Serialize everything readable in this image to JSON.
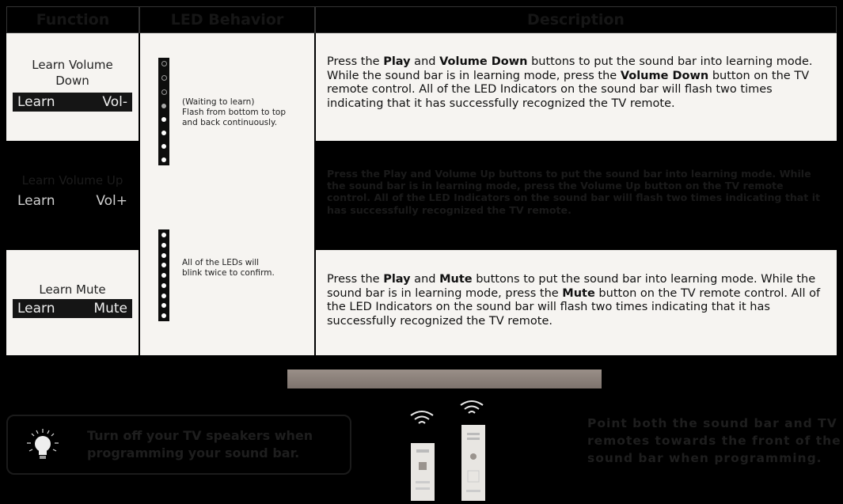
{
  "headers": {
    "function": "Function",
    "led": "LED Behavior",
    "description": "Description"
  },
  "rows": [
    {
      "function_name": "Learn Volume Down",
      "tag_left": "Learn",
      "tag_right": "Vol-",
      "desc_parts": [
        "Press the ",
        "Play",
        " and ",
        "Volume Down",
        " buttons to put the sound bar into learning mode. While the sound bar is in learning mode, press the ",
        "Volume Down",
        " button on the TV remote control. All of the LED Indicators on the sound bar will flash two times indicating that it has successfully recognized the TV remote."
      ]
    },
    {
      "function_name": "Learn Volume Up",
      "tag_left": "Learn",
      "tag_right": "Vol+",
      "desc_parts": [
        "Press the ",
        "Play",
        " and ",
        "Volume Up",
        " buttons to put the sound bar into learning mode. While the sound bar is in learning mode, press the ",
        "Volume Up",
        " button on the TV remote control. All of the LED Indicators on the sound bar will flash two times indicating that it has successfully recognized the TV remote."
      ]
    },
    {
      "function_name": "Learn Mute",
      "tag_left": "Learn",
      "tag_right": "Mute",
      "desc_parts": [
        "Press the ",
        "Play",
        " and ",
        "Mute",
        " buttons to put the sound bar into learning mode. While the sound bar is in learning mode, press the ",
        "Mute",
        " button on the TV remote control. All of the LED Indicators on the sound bar will flash two times indicating that it has successfully recognized the TV remote."
      ]
    }
  ],
  "led_behavior": {
    "waiting_line1": "(Waiting to learn)",
    "waiting_line2": "Flash from bottom to top",
    "waiting_line3": "and back continuously.",
    "confirm_line1": "All of the LEDs will",
    "confirm_line2": "blink twice to confirm."
  },
  "tips": {
    "speakers_line1": "Turn off your TV speakers when",
    "speakers_line2": "programming your sound bar.",
    "remotes_line1": "Point both the sound bar and TV",
    "remotes_line2": "remotes towards the front of the",
    "remotes_line3": "sound bar when programming."
  },
  "colors": {
    "background": "#000000",
    "light_row": "#f6f4f1",
    "soundbar": "#8a807a",
    "text": "#111111"
  },
  "icons": {
    "lightbulb": "lightbulb-icon",
    "wifi": "wifi-signal-icon",
    "remote": "remote-control-icon"
  }
}
